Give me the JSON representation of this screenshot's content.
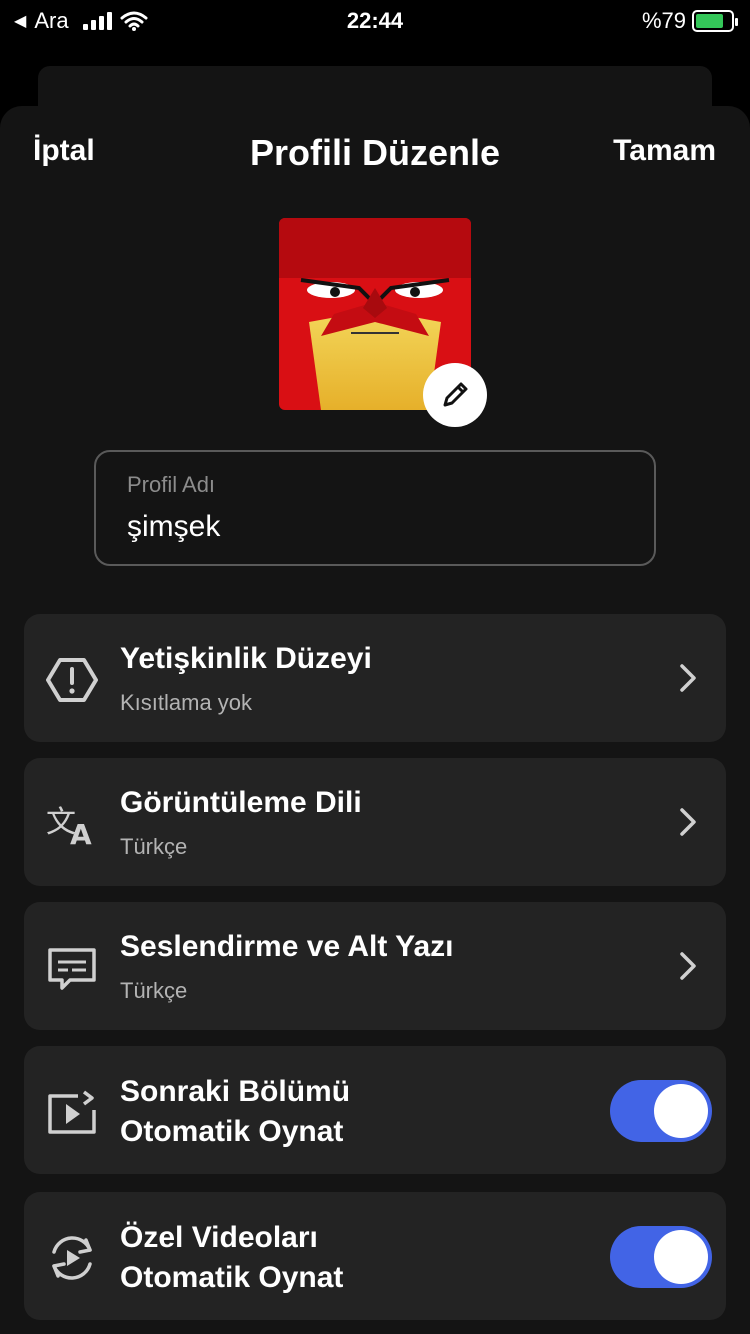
{
  "status_bar": {
    "carrier": "Ara",
    "time": "22:44",
    "battery": "%79"
  },
  "header": {
    "cancel": "İptal",
    "title": "Profili Düzenle",
    "done": "Tamam"
  },
  "profile_name": {
    "label": "Profil Adı",
    "value": "şimşek"
  },
  "settings": [
    {
      "title": "Yetişkinlik Düzeyi",
      "subtitle": "Kısıtlama yok",
      "icon": "warning-icon"
    },
    {
      "title": "Görüntüleme Dili",
      "subtitle": "Türkçe",
      "icon": "translate-icon"
    },
    {
      "title": "Seslendirme ve Alt Yazı",
      "subtitle": "Türkçe",
      "icon": "subtitles-icon"
    }
  ],
  "toggles": [
    {
      "title_line1": "Sonraki Bölümü",
      "title_line2": "Otomatik Oynat",
      "enabled": true,
      "icon": "autoplay-next-icon"
    },
    {
      "title_line1": "Özel Videoları",
      "title_line2": "Otomatik Oynat",
      "enabled": true,
      "icon": "autoplay-previews-icon"
    }
  ],
  "colors": {
    "toggle_on": "#4264e6",
    "battery_fill": "#34c759",
    "card_bg": "#232323",
    "sheet_bg": "#141414"
  }
}
